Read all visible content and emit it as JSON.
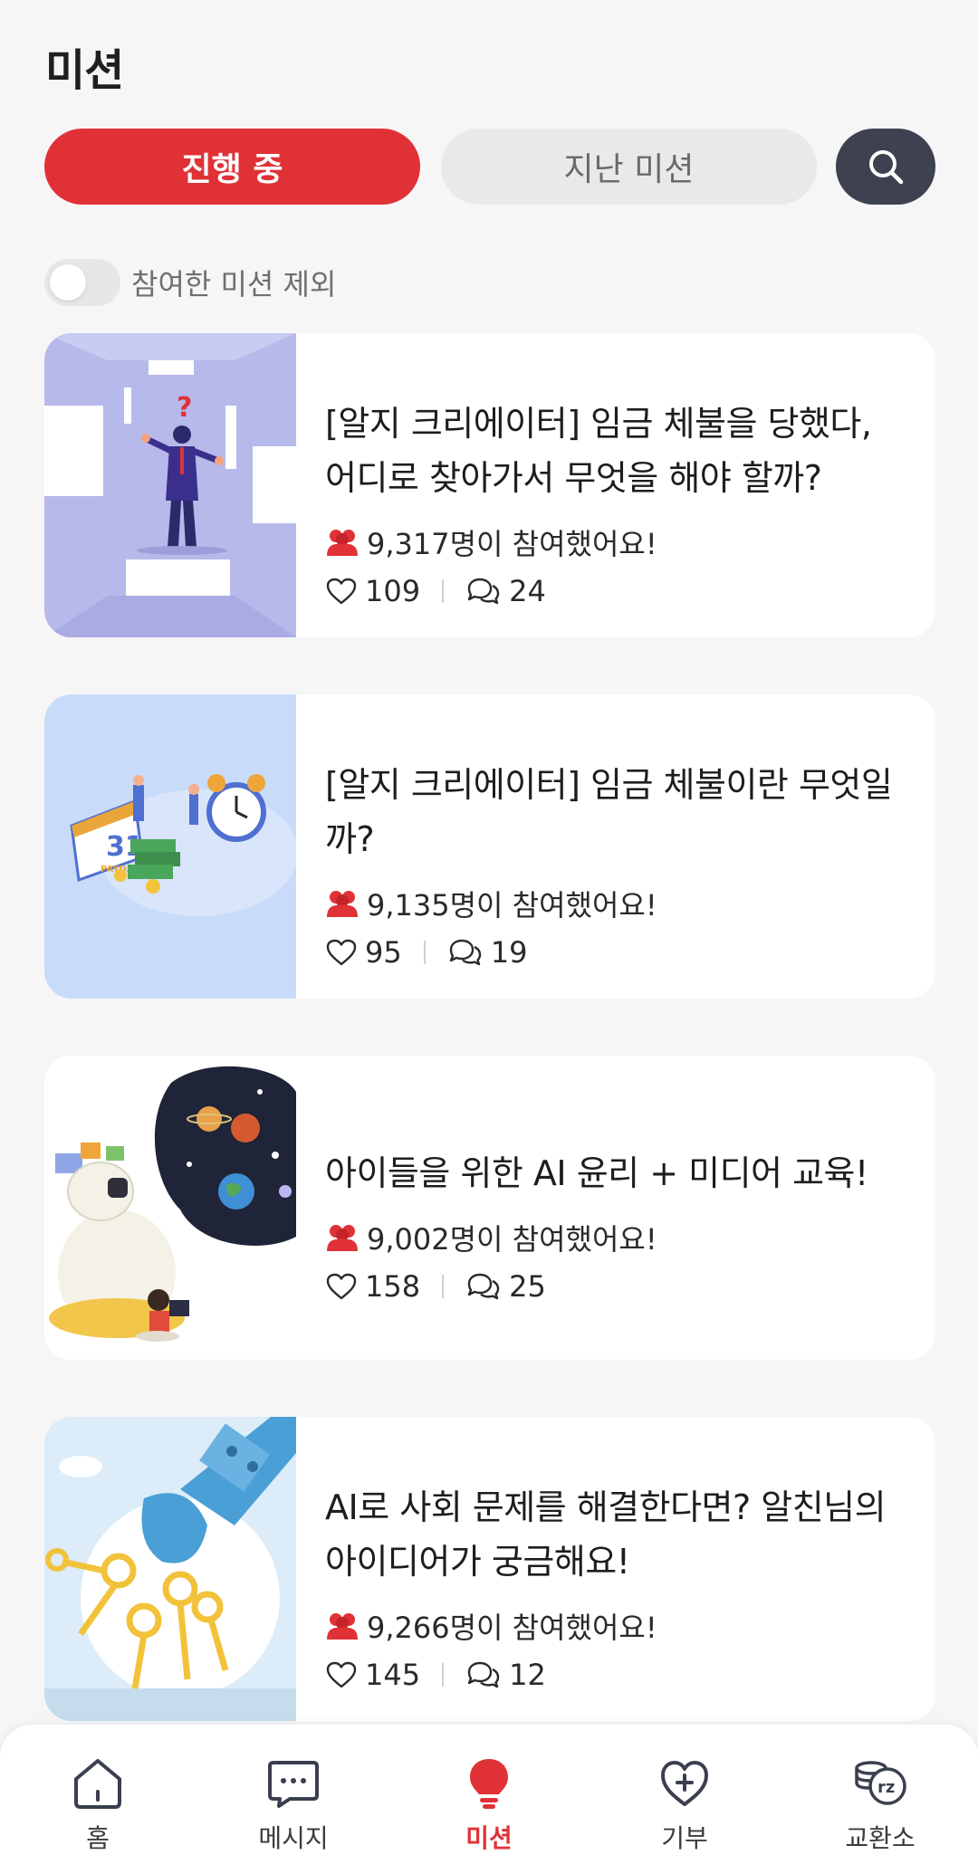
{
  "header": {
    "title": "미션"
  },
  "tabs": {
    "active": "진행 중",
    "inactive": "지난 미션"
  },
  "filter": {
    "label": "참여한 미션 제외",
    "checked": false
  },
  "missions": [
    {
      "title": "[알지 크리에이터] 임금 체불을 당했다, 어디로 찾아가서 무엇을 해야 할까?",
      "participants": "9,317명이 참여했어요!",
      "likes": "109",
      "comments": "24"
    },
    {
      "title": "[알지 크리에이터] 임금 체불이란 무엇일까?",
      "participants": "9,135명이 참여했어요!",
      "likes": "95",
      "comments": "19"
    },
    {
      "title": "아이들을 위한 AI 윤리 + 미디어 교육!",
      "participants": "9,002명이 참여했어요!",
      "likes": "158",
      "comments": "25"
    },
    {
      "title": "AI로 사회 문제를 해결한다면? 알친님의 아이디어가 궁금해요!",
      "participants": "9,266명이 참여했어요!",
      "likes": "145",
      "comments": "12"
    }
  ],
  "nav": {
    "items": [
      {
        "label": "홈",
        "icon": "home-icon"
      },
      {
        "label": "메시지",
        "icon": "message-icon"
      },
      {
        "label": "미션",
        "icon": "mission-bulb-icon",
        "active": true
      },
      {
        "label": "기부",
        "icon": "donate-heart-icon"
      },
      {
        "label": "교환소",
        "icon": "exchange-coin-icon"
      }
    ]
  },
  "colors": {
    "accent": "#e03236",
    "search_bg": "#3d4150",
    "tab_inactive": "#e9e9ea"
  }
}
